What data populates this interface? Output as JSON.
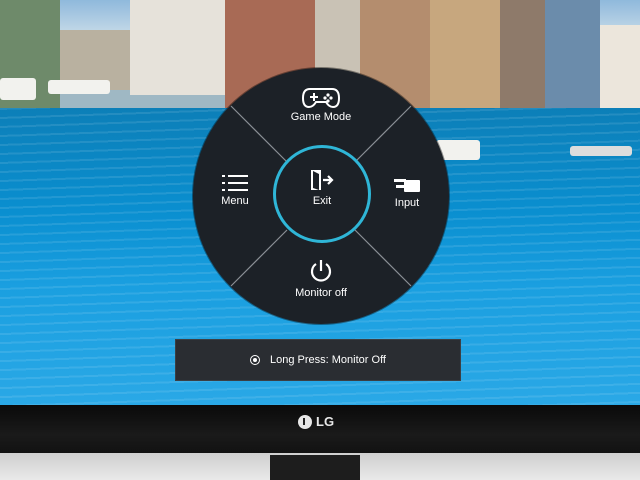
{
  "osd": {
    "top_label": "Game Mode",
    "left_label": "Menu",
    "right_label": "Input",
    "bottom_label": "Monitor off",
    "center_label": "Exit",
    "accent_color": "#2fb6d7",
    "icons": {
      "top": "gamepad-icon",
      "left": "menu-list-icon",
      "right": "input-source-icon",
      "bottom": "power-icon",
      "center": "exit-door-icon"
    }
  },
  "hint": {
    "text": "Long Press: Monitor Off"
  },
  "bezel": {
    "brand": "LG"
  }
}
